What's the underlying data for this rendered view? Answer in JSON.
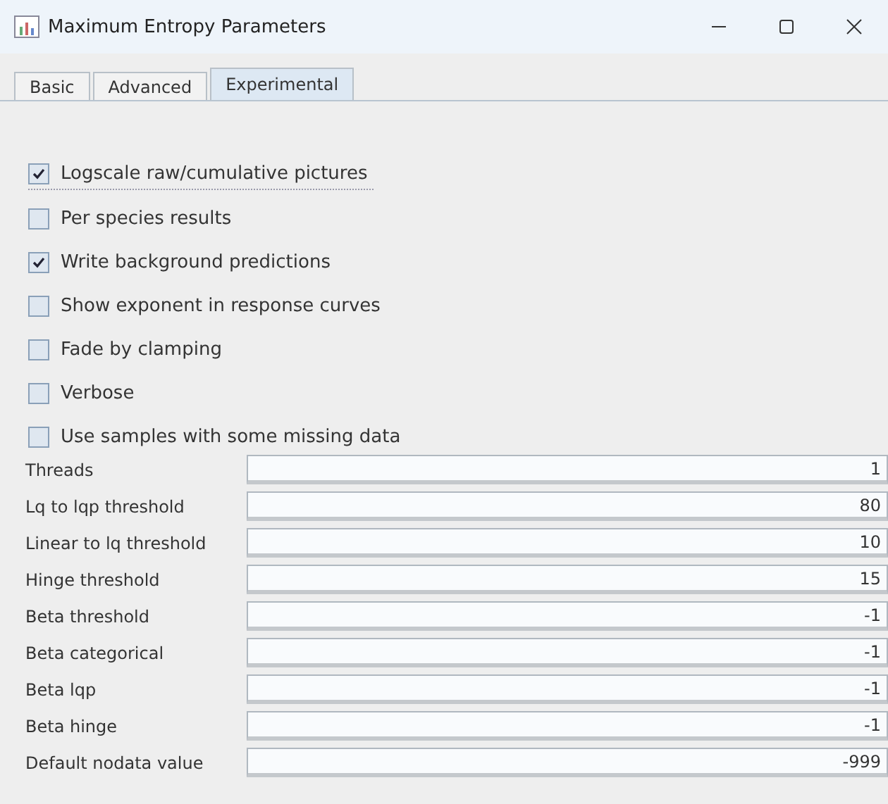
{
  "window": {
    "title": "Maximum Entropy Parameters"
  },
  "tabs": [
    {
      "label": "Basic",
      "selected": false
    },
    {
      "label": "Advanced",
      "selected": false
    },
    {
      "label": "Experimental",
      "selected": true
    }
  ],
  "options": [
    {
      "label": "Logscale raw/cumulative pictures",
      "checked": true,
      "focused": true
    },
    {
      "label": "Per species results",
      "checked": false,
      "focused": false
    },
    {
      "label": "Write background predictions",
      "checked": true,
      "focused": false
    },
    {
      "label": "Show exponent in response curves",
      "checked": false,
      "focused": false
    },
    {
      "label": "Fade by clamping",
      "checked": false,
      "focused": false
    },
    {
      "label": "Verbose",
      "checked": false,
      "focused": false
    },
    {
      "label": "Use samples with some missing data",
      "checked": false,
      "focused": false
    }
  ],
  "fields": [
    {
      "label": "Threads",
      "value": "1"
    },
    {
      "label": "Lq to lqp threshold",
      "value": "80"
    },
    {
      "label": "Linear to lq threshold",
      "value": "10"
    },
    {
      "label": "Hinge threshold",
      "value": "15"
    },
    {
      "label": "Beta threshold",
      "value": "-1"
    },
    {
      "label": "Beta categorical",
      "value": "-1"
    },
    {
      "label": "Beta lqp",
      "value": "-1"
    },
    {
      "label": "Beta hinge",
      "value": "-1"
    },
    {
      "label": "Default nodata value",
      "value": "-999"
    }
  ]
}
